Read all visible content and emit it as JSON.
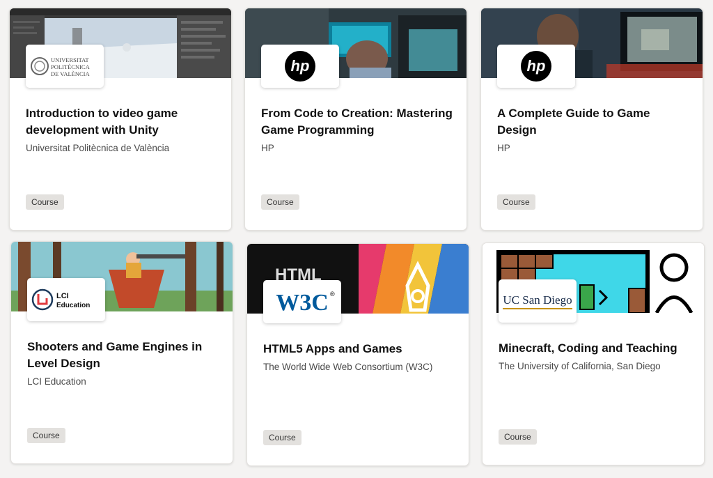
{
  "courses": [
    {
      "title": "Introduction to video game development with Unity",
      "partner": "Universitat Politècnica de València",
      "type": "Course",
      "logo": {
        "line1": "UNIVERSITAT",
        "line2": "POLITÈCNICA",
        "line3": "DE VALÈNCIA"
      }
    },
    {
      "title": "From Code to Creation: Mastering Game Programming",
      "partner": "HP",
      "type": "Course",
      "logo": {
        "text": "hp"
      }
    },
    {
      "title": "A Complete Guide to Game Design",
      "partner": "HP",
      "type": "Course",
      "logo": {
        "text": "hp"
      }
    },
    {
      "title": "Shooters and Game Engines in Level Design",
      "partner": "LCI Education",
      "type": "Course",
      "logo": {
        "line1": "LCI",
        "line2": "Education"
      }
    },
    {
      "title": "HTML5 Apps and Games",
      "partner": "The World Wide Web Consortium (W3C)",
      "type": "Course",
      "logo": {
        "text": "W3C",
        "reg": "®"
      },
      "banner_text": "HTML"
    },
    {
      "title": "Minecraft, Coding and Teaching",
      "partner": "The University of California, San Diego",
      "type": "Course",
      "logo": {
        "text": "UC San Diego"
      }
    }
  ],
  "colors": {
    "badge_bg": "#e3e1de",
    "uc_blue": "#182b49",
    "w3c_blue": "#005a9c",
    "lci_red": "#e03a3e",
    "hp_black": "#000000"
  }
}
